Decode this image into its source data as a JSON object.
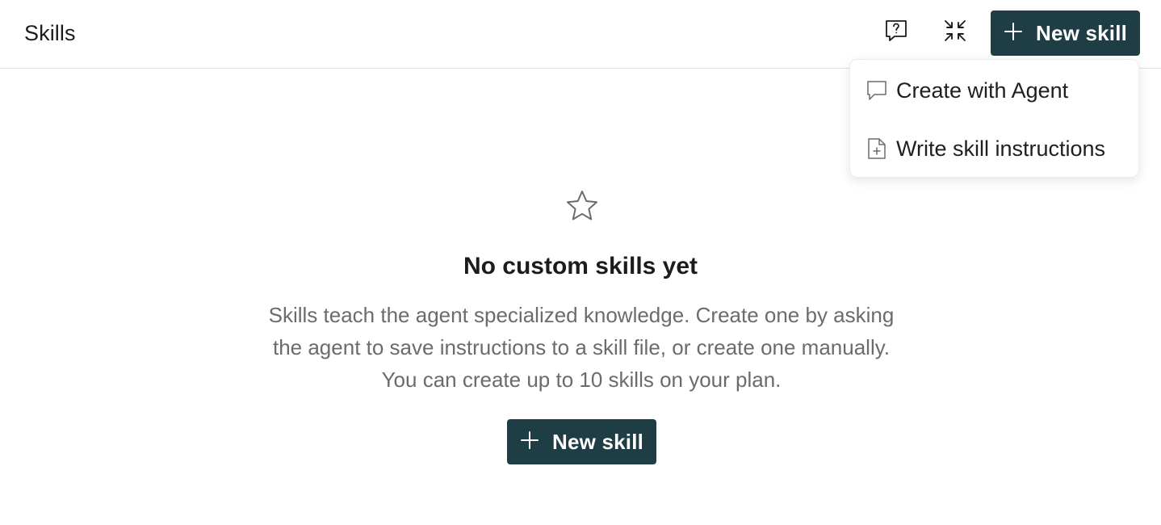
{
  "header": {
    "title": "Skills",
    "feedback_icon": "feedback-question-icon",
    "collapse_icon": "collapse-arrows-icon",
    "new_skill_label": "New skill"
  },
  "dropdown": {
    "items": [
      {
        "label": "Create with Agent",
        "icon": "chat-bubble-icon"
      },
      {
        "label": "Write skill instructions",
        "icon": "file-plus-icon"
      }
    ]
  },
  "empty_state": {
    "icon": "star-icon",
    "title": "No custom skills yet",
    "description": "Skills teach the agent specialized knowledge. Create one by asking the agent to save instructions to a skill file, or create one manually. You can create up to 10 skills on your plan.",
    "button_label": "New skill"
  },
  "colors": {
    "primary": "#1e3d44",
    "border": "#e3e3e3",
    "muted_text": "#6b6b6b"
  }
}
